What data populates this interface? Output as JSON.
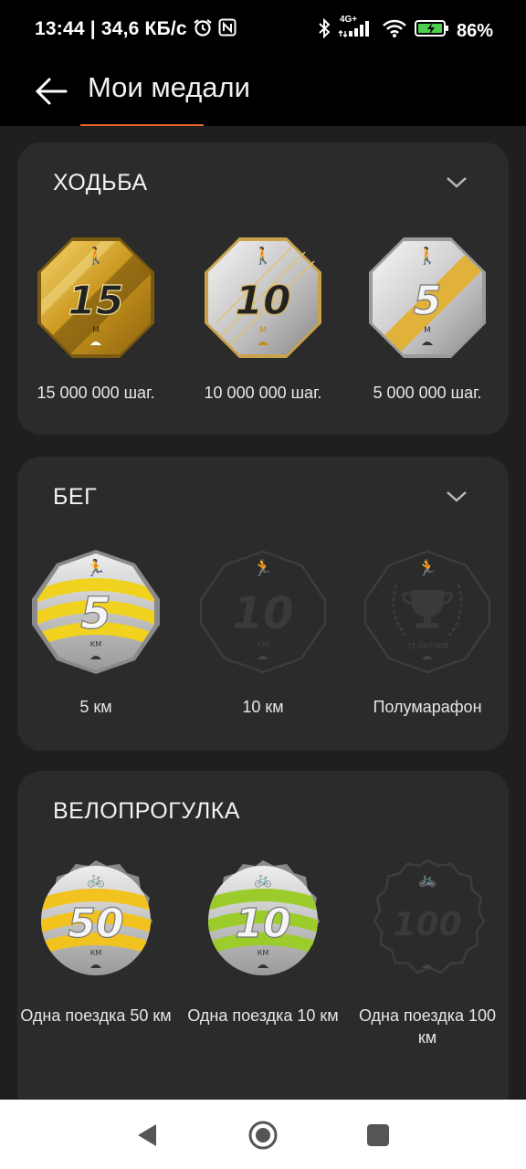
{
  "status_bar": {
    "left_text": "13:44 | 34,6 КБ/с",
    "network": "4G+",
    "battery": "86%",
    "icons": [
      "alarm-icon",
      "nfc-icon",
      "bluetooth-icon",
      "signal-icon",
      "wifi-icon",
      "battery-icon"
    ]
  },
  "app_bar": {
    "title": "Мои медали"
  },
  "sections": [
    {
      "title": "ХОДЬБА",
      "medals": [
        {
          "label": "15 000 000 шаг.",
          "number": "15",
          "unit": "M",
          "style": "gold",
          "achieved": true
        },
        {
          "label": "10 000 000 шаг.",
          "number": "10",
          "unit": "M",
          "style": "silver-gold",
          "achieved": true
        },
        {
          "label": "5 000 000 шаг.",
          "number": "5",
          "unit": "M",
          "style": "silver-stripe",
          "achieved": true
        }
      ]
    },
    {
      "title": "БЕГ",
      "medals": [
        {
          "label": "5 км",
          "number": "5",
          "unit": "КМ",
          "style": "yellow-wave",
          "achieved": true
        },
        {
          "label": "10 км",
          "number": "10",
          "unit": "КМ",
          "style": "locked",
          "achieved": false
        },
        {
          "label": "Полумарафон",
          "number": "",
          "unit": "21.0975KM",
          "style": "locked-trophy",
          "achieved": false
        }
      ]
    },
    {
      "title": "ВЕЛОПРОГУЛКА",
      "medals": [
        {
          "label": "Одна поездка 50 км",
          "number": "50",
          "unit": "КМ",
          "style": "yellow-wave",
          "achieved": true
        },
        {
          "label": "Одна поездка 10 км",
          "number": "10",
          "unit": "КМ",
          "style": "green-wave",
          "achieved": true
        },
        {
          "label": "Одна поездка 100 км",
          "number": "100",
          "unit": "",
          "style": "locked",
          "achieved": false
        }
      ]
    }
  ],
  "colors": {
    "accent": "#e8632a",
    "card": "#2b2b2b",
    "background": "#1f1f1f"
  }
}
